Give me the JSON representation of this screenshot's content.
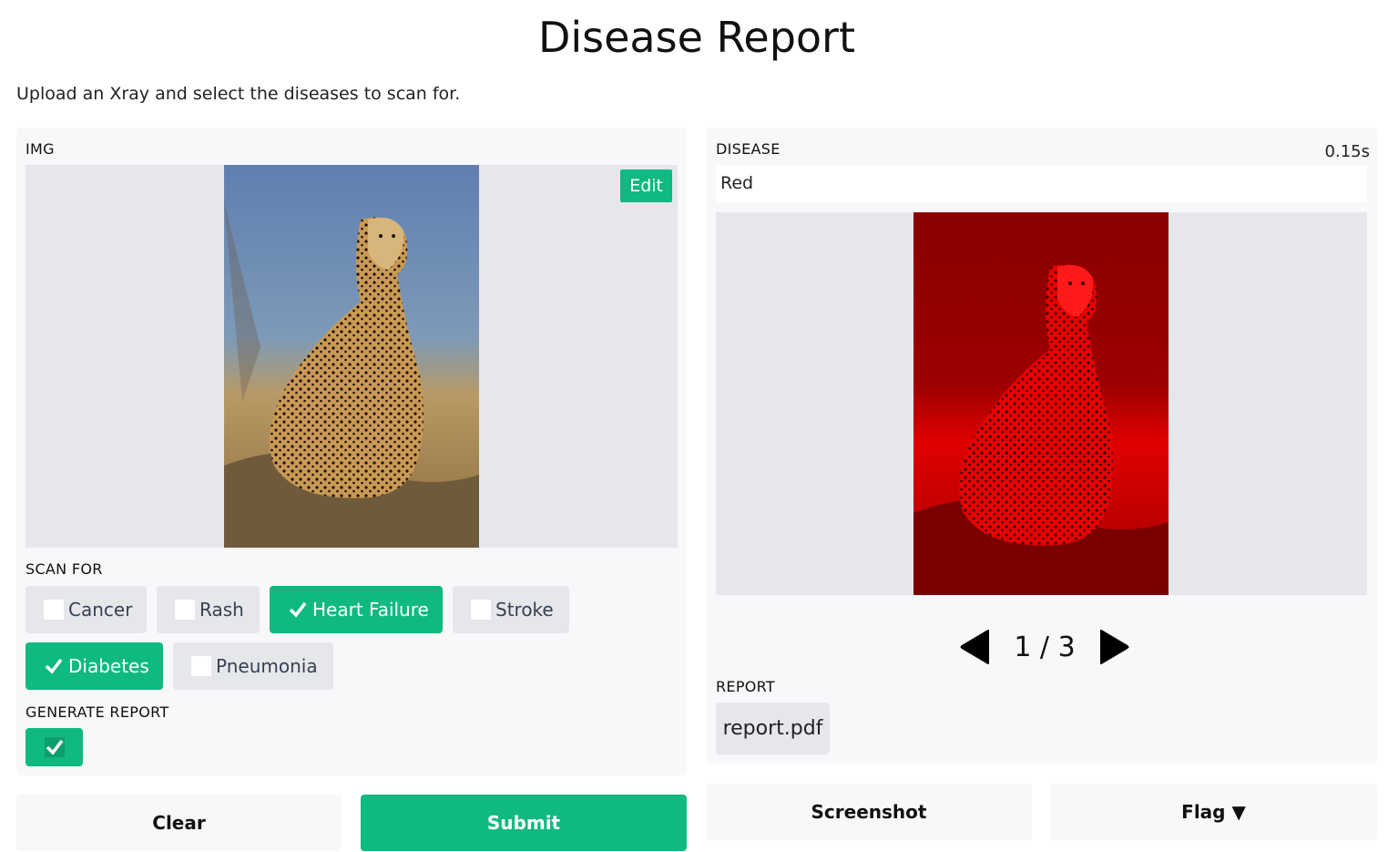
{
  "header": {
    "title": "Disease Report",
    "subtitle": "Upload an Xray and select the diseases to scan for."
  },
  "input": {
    "image_label": "IMG",
    "edit_label": "Edit",
    "scan_label": "SCAN FOR",
    "diseases": [
      {
        "label": "Cancer",
        "checked": false
      },
      {
        "label": "Rash",
        "checked": false
      },
      {
        "label": "Heart Failure",
        "checked": true
      },
      {
        "label": "Stroke",
        "checked": false
      },
      {
        "label": "Diabetes",
        "checked": true
      },
      {
        "label": "Pneumonia",
        "checked": false
      }
    ],
    "generate_report_label": "GENERATE REPORT",
    "generate_report_checked": true
  },
  "output": {
    "disease_label": "DISEASE",
    "timer": "0.15s",
    "disease_value": "Red",
    "pager": {
      "current": 1,
      "total": 3,
      "text": "1 / 3"
    },
    "report_label": "REPORT",
    "report_file": "report.pdf"
  },
  "actions": {
    "clear_label": "Clear",
    "submit_label": "Submit",
    "screenshot_label": "Screenshot",
    "flag_label": "Flag ▼"
  },
  "colors": {
    "accent": "#10b981",
    "panel_bg": "#f7f8fa",
    "image_bg": "#e5e7eb",
    "output_tint": "#ff0000"
  }
}
